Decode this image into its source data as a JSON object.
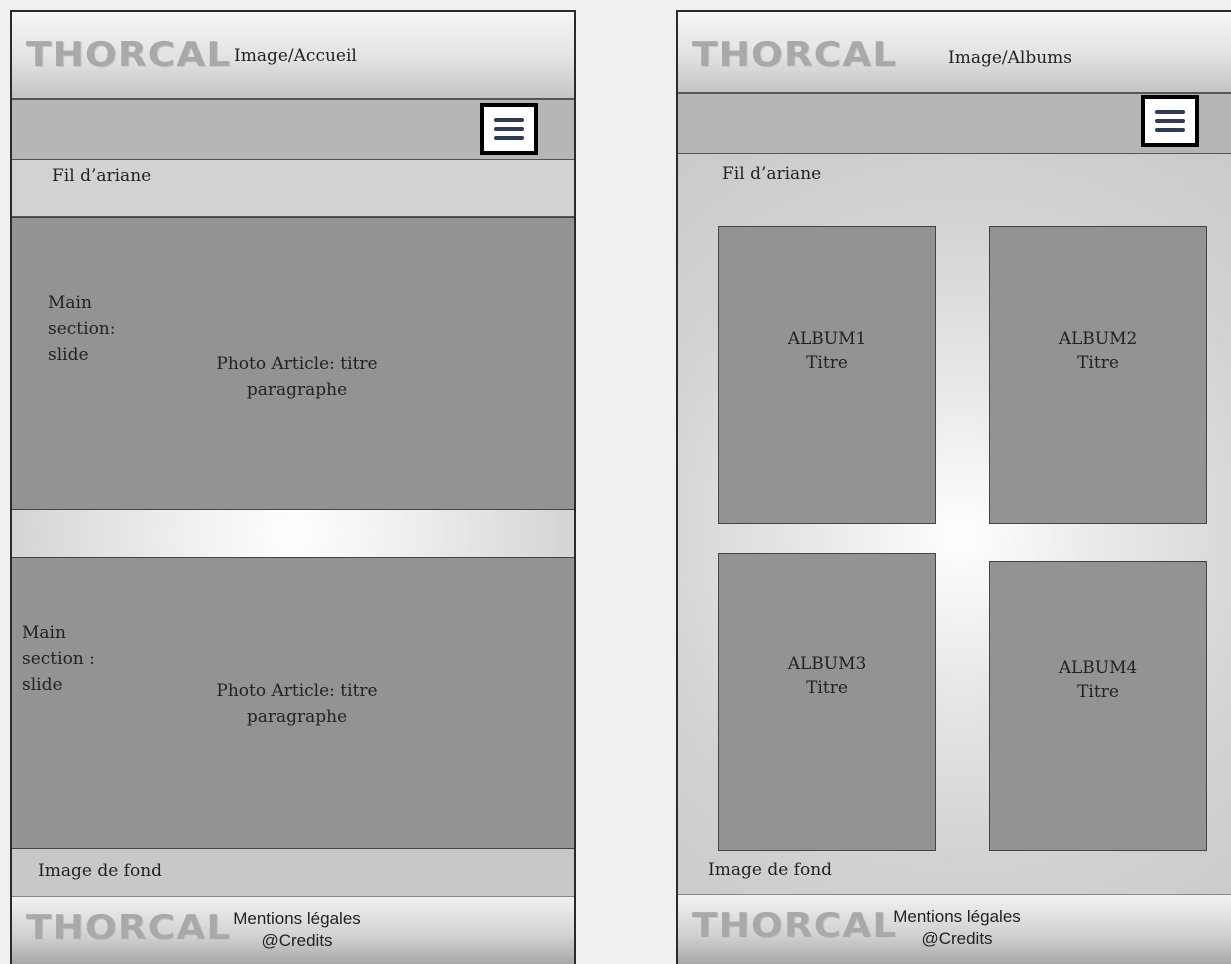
{
  "mockups": {
    "left": {
      "header": {
        "logo": "THORCAL",
        "page_name": "Image/Accueil"
      },
      "menu_icon": "hamburger-menu-icon",
      "breadcrumb": "Fil d’ariane",
      "slides": [
        {
          "label": "Main section: slide",
          "article_line1": "Photo Article: titre",
          "article_line2": "paragraphe"
        },
        {
          "label": "Main section : slide",
          "article_line1": "Photo Article: titre",
          "article_line2": "paragraphe"
        }
      ],
      "background_label": "Image de fond",
      "footer": {
        "logo": "THORCAL",
        "legal": "Mentions légales",
        "credits": "@Credits"
      }
    },
    "right": {
      "header": {
        "logo": "THORCAL",
        "page_name": "Image/Albums"
      },
      "menu_icon": "hamburger-menu-icon",
      "breadcrumb": "Fil d’ariane",
      "albums": [
        {
          "name": "ALBUM1",
          "title": "Titre"
        },
        {
          "name": "ALBUM2",
          "title": "Titre"
        },
        {
          "name": "ALBUM3",
          "title": "Titre"
        },
        {
          "name": "ALBUM4",
          "title": "Titre"
        }
      ],
      "background_label": "Image de fond",
      "footer": {
        "logo": "THORCAL",
        "legal": "Mentions légales",
        "credits": "@Credits"
      }
    }
  },
  "colors": {
    "page_background": "#f0f0f0",
    "content_block": "#939393",
    "menu_icon_bars": "#2e3d55"
  }
}
